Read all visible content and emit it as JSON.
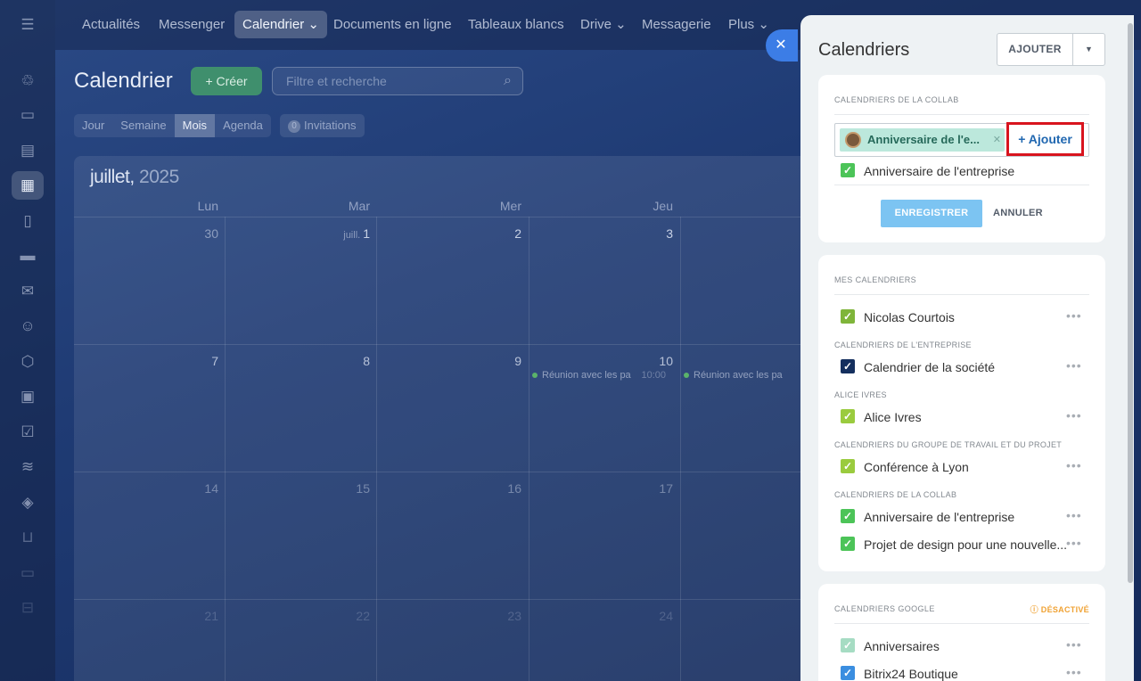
{
  "topnav": {
    "items": [
      {
        "label": "Actualités"
      },
      {
        "label": "Messenger"
      },
      {
        "label": "Calendrier ⌄"
      },
      {
        "label": "Documents en ligne"
      },
      {
        "label": "Tableaux blancs"
      },
      {
        "label": "Drive ⌄"
      },
      {
        "label": "Messagerie"
      },
      {
        "label": "Plus ⌄"
      }
    ]
  },
  "header": {
    "title": "Calendrier",
    "create_label": "+ Créer",
    "search_placeholder": "Filtre et recherche",
    "views": [
      "Jour",
      "Semaine",
      "Mois",
      "Agenda"
    ],
    "active_view": "Mois",
    "invitations_count": "0",
    "invitations_label": "Invitations"
  },
  "calendar": {
    "month": "juillet,",
    "year": "2025",
    "weekdays": [
      "Lun",
      "Mar",
      "Mer",
      "Jeu"
    ],
    "weeks": [
      [
        "30",
        "1",
        "2",
        "3"
      ],
      [
        "7",
        "8",
        "9",
        "10"
      ],
      [
        "14",
        "15",
        "16",
        "17"
      ],
      [
        "21",
        "22",
        "23",
        "24"
      ]
    ],
    "month_prefix": "juill.",
    "events": [
      {
        "title": "Réunion avec les pa",
        "time": "10:00"
      },
      {
        "title": "Réunion avec les pa",
        "time": ""
      }
    ]
  },
  "panel": {
    "title": "Calendriers",
    "add_button": "AJOUTER",
    "collab_card": {
      "header": "CALENDRIERS DE LA COLLAB",
      "tag_label": "Anniversaire de l'e...",
      "add_link": "+ Ajouter",
      "checked_item": "Anniversaire de l'entreprise",
      "save": "ENREGISTRER",
      "cancel": "ANNULER"
    },
    "my_card": {
      "header": "MES CALENDRIERS",
      "sections": [
        {
          "sub": "",
          "items": [
            {
              "label": "Nicolas Courtois",
              "color": "#7fb53a"
            }
          ]
        },
        {
          "sub": "CALENDRIERS DE L'ENTREPRISE",
          "items": [
            {
              "label": "Calendrier de la société",
              "color": "#142f5e"
            }
          ]
        },
        {
          "sub": "ALICE IVRES",
          "items": [
            {
              "label": "Alice Ivres",
              "color": "#9acb3e"
            }
          ]
        },
        {
          "sub": "CALENDRIERS DU GROUPE DE TRAVAIL ET DU PROJET",
          "items": [
            {
              "label": "Conférence à Lyon",
              "color": "#9acb3e"
            }
          ]
        },
        {
          "sub": "CALENDRIERS DE LA COLLAB",
          "items": [
            {
              "label": "Anniversaire de l'entreprise",
              "color": "#4cc458"
            },
            {
              "label": "Projet de design pour une nouvelle...",
              "color": "#4cc458"
            }
          ]
        }
      ]
    },
    "google_card": {
      "header": "CALENDRIERS GOOGLE",
      "status": "DÉSACTIVÉ",
      "items": [
        {
          "label": "Anniversaires",
          "color": "#a6dcc3"
        },
        {
          "label": "Bitrix24 Boutique",
          "color": "#3b8ee0"
        }
      ]
    }
  }
}
